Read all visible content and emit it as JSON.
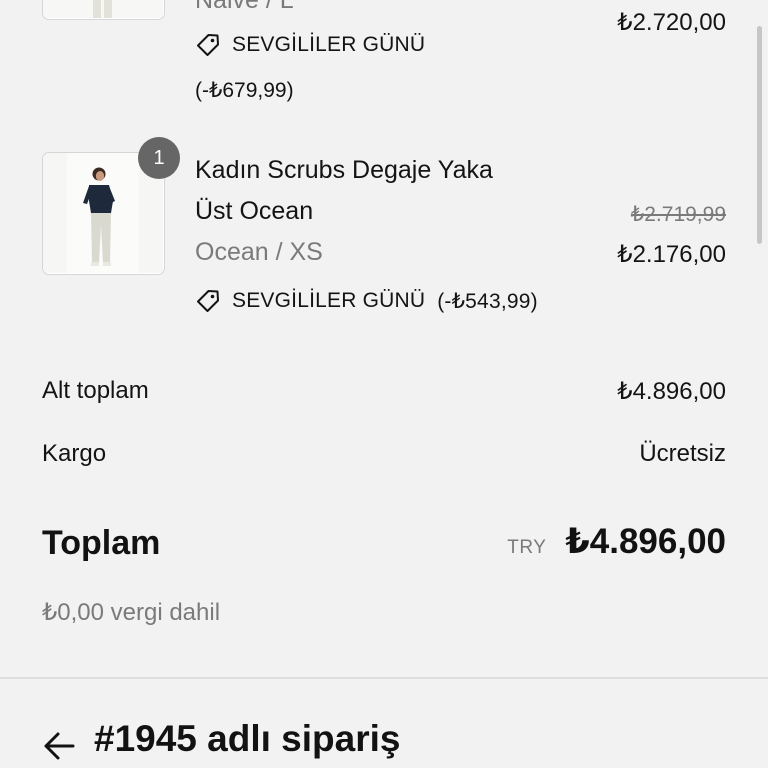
{
  "colors": {
    "background": "#f2f2f2",
    "text_primary": "#141414",
    "text_muted": "#7a7a7a",
    "badge_bg": "#666666",
    "divider": "#dedede"
  },
  "items": [
    {
      "variant": "Naive / L",
      "price": "₺2.720,00",
      "discount_name": "SEVGİLİLER GÜNÜ",
      "discount_amount": "(-₺679,99)"
    },
    {
      "quantity": "1",
      "title_line1": "Kadın Scrubs Degaje Yaka",
      "title_line2": "Üst Ocean",
      "variant": "Ocean / XS",
      "original_price": "₺2.719,99",
      "price": "₺2.176,00",
      "discount_name": "SEVGİLİLER GÜNÜ",
      "discount_amount": "(-₺543,99)"
    }
  ],
  "summary": {
    "subtotal_label": "Alt toplam",
    "subtotal_value": "₺4.896,00",
    "shipping_label": "Kargo",
    "shipping_value": "Ücretsiz",
    "total_label": "Toplam",
    "currency_code": "TRY",
    "total_value": "₺4.896,00",
    "tax_note": "₺0,00 vergi dahil"
  },
  "order": {
    "title": "#1945 adlı sipariş",
    "back_icon": "arrow-left-icon"
  },
  "icons": {
    "discount": "tag-icon"
  }
}
